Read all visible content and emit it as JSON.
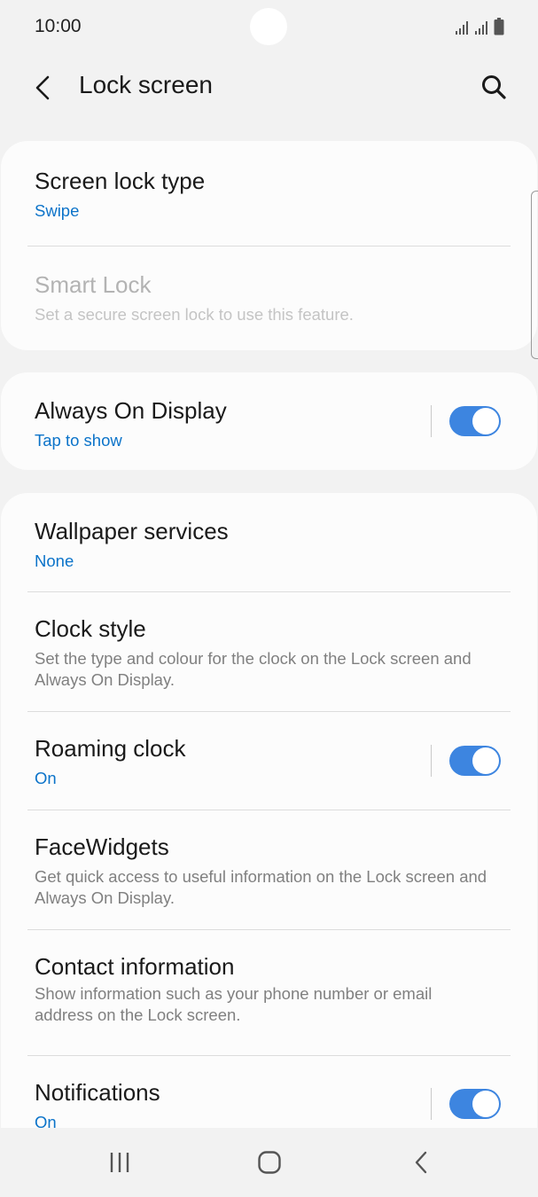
{
  "status_bar": {
    "time": "10:00"
  },
  "header": {
    "title": "Lock screen",
    "icons": [
      "back-icon",
      "search-icon"
    ]
  },
  "sections": [
    {
      "items": [
        {
          "title": "Screen lock type",
          "subtitle": "Swipe"
        },
        {
          "title": "Smart Lock",
          "description": "Set a secure screen lock to use this feature.",
          "disabled": true
        }
      ]
    },
    {
      "items": [
        {
          "title": "Always On Display",
          "subtitle": "Tap to show",
          "toggle": true
        }
      ]
    },
    {
      "items": [
        {
          "title": "Wallpaper services",
          "subtitle": "None"
        },
        {
          "title": "Clock style",
          "description": "Set the type and colour for the clock on the Lock screen and Always On Display."
        },
        {
          "title": "Roaming clock",
          "subtitle": "On",
          "toggle": true
        },
        {
          "title": "FaceWidgets",
          "description": "Get quick access to useful information on the Lock screen and Always On Display."
        },
        {
          "title": "Contact information",
          "description": "Show information such as your phone number or email address on the Lock screen."
        },
        {
          "title": "Notifications",
          "subtitle": "On",
          "toggle": true
        }
      ]
    }
  ],
  "nav_bar": {
    "icons": [
      "recent-apps-icon",
      "home-icon",
      "back-nav-icon"
    ]
  },
  "colors": {
    "accent": "#0b73c9",
    "toggle_on": "#3d85e0",
    "background": "#f2f2f2",
    "card": "#fcfcfc"
  }
}
